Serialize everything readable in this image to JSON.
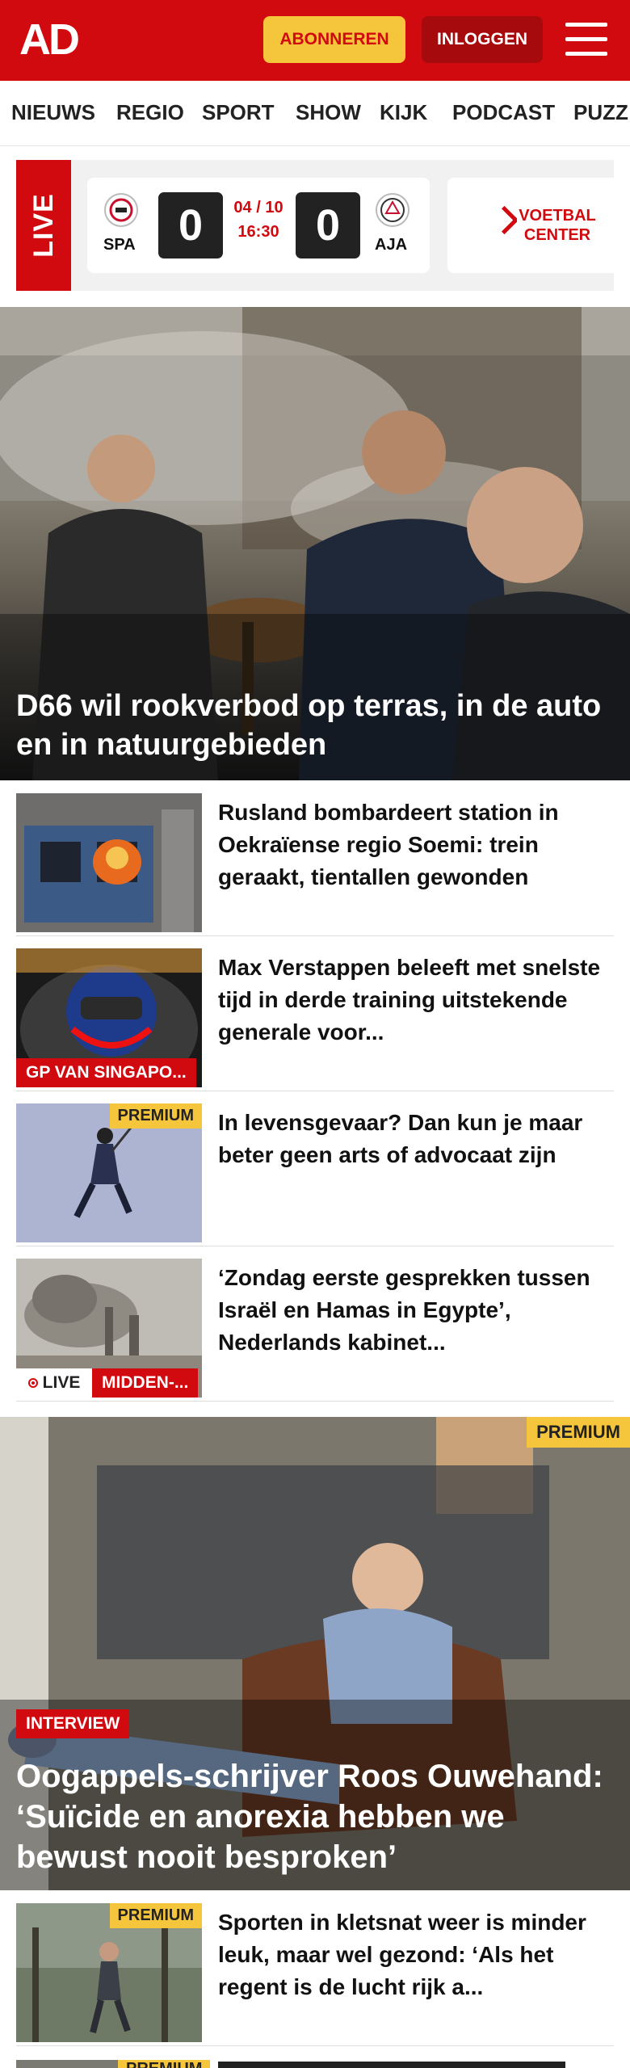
{
  "header": {
    "logo": "AD",
    "subscribe_label": "ABONNEREN",
    "login_label": "INLOGGEN"
  },
  "nav": {
    "items": [
      "NIEUWS",
      "REGIO",
      "SPORT",
      "SHOW",
      "KIJK",
      "PODCAST",
      "PUZZ"
    ]
  },
  "live": {
    "label": "LIVE",
    "match": {
      "home": "SPA",
      "away": "AJA",
      "home_score": "0",
      "away_score": "0",
      "date": "04 / 10",
      "time": "16:30"
    },
    "voetbal_center": "VOETBAL CENTER"
  },
  "hero": {
    "title": "D66 wil rookverbod op terras, in de auto en in natuurgebieden"
  },
  "articles": [
    {
      "title": "Rusland bombardeert station in Oekraïense regio Soemi: trein geraakt, tientallen gewonden"
    },
    {
      "title": "Max Verstappen beleeft met snelste tijd in derde training uitstekende generale voor...",
      "label": "GP VAN SINGAPO..."
    },
    {
      "title": "In levensgevaar? Dan kun je maar beter geen arts of advocaat zijn",
      "badge": "PREMIUM"
    },
    {
      "title": "‘Zondag eerste gesprekken tussen Israël en Hamas in Egypte’, Nederlands kabinet...",
      "live_label": "LIVE",
      "label": "MIDDEN-..."
    }
  ],
  "feature": {
    "badge": "PREMIUM",
    "label": "INTERVIEW",
    "title": "Oogappels-schrijver Roos Ouwehand: ‘Suïcide en anorexia hebben we bewust nooit besproken’"
  },
  "articles2": [
    {
      "title": "Sporten in kletsnat weer is minder leuk, maar wel gezond: ‘Als het regent is de lucht rijk a...",
      "badge": "PREMIUM"
    },
    {
      "badge": "PREMIUM"
    }
  ]
}
